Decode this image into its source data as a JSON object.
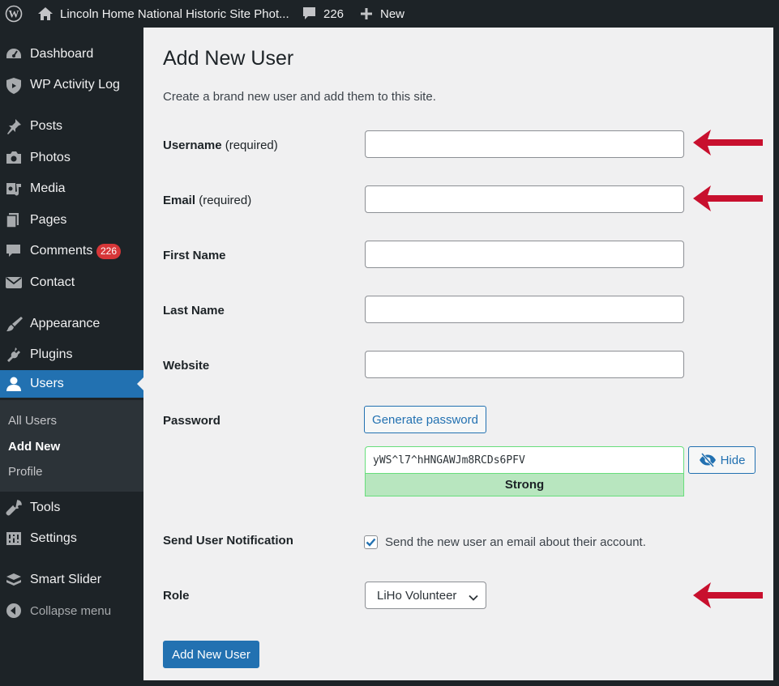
{
  "admin_bar": {
    "site_name": "Lincoln Home National Historic Site Phot...",
    "comments_count": "226",
    "new_label": "New"
  },
  "sidebar": {
    "items": [
      {
        "label": "Dashboard",
        "icon": "dashboard-icon"
      },
      {
        "label": "WP Activity Log",
        "icon": "shield-icon"
      },
      {
        "label": "Posts",
        "icon": "pushpin-icon"
      },
      {
        "label": "Photos",
        "icon": "camera-icon"
      },
      {
        "label": "Media",
        "icon": "media-icon"
      },
      {
        "label": "Pages",
        "icon": "pages-icon"
      },
      {
        "label": "Comments",
        "icon": "comment-icon",
        "badge": "226"
      },
      {
        "label": "Contact",
        "icon": "envelope-icon"
      },
      {
        "label": "Appearance",
        "icon": "paintbrush-icon"
      },
      {
        "label": "Plugins",
        "icon": "plug-icon"
      },
      {
        "label": "Users",
        "icon": "user-icon",
        "current": true
      },
      {
        "label": "Tools",
        "icon": "wrench-icon"
      },
      {
        "label": "Settings",
        "icon": "settings-icon"
      },
      {
        "label": "Smart Slider",
        "icon": "slider-icon"
      },
      {
        "label": "Collapse menu",
        "icon": "collapse-icon"
      }
    ],
    "submenu": [
      {
        "label": "All Users"
      },
      {
        "label": "Add New",
        "current": true
      },
      {
        "label": "Profile"
      }
    ]
  },
  "page": {
    "title": "Add New User",
    "description": "Create a brand new user and add them to this site."
  },
  "form": {
    "username_label": "Username",
    "username_req": "(required)",
    "username_value": "",
    "email_label": "Email",
    "email_req": "(required)",
    "email_value": "",
    "first_name_label": "First Name",
    "first_name_value": "",
    "last_name_label": "Last Name",
    "last_name_value": "",
    "website_label": "Website",
    "website_value": "",
    "password_label": "Password",
    "generate_password_label": "Generate password",
    "password_value": "yWS^l7^hHNGAWJm8RCDs6PFV",
    "password_strength": "Strong",
    "hide_label": "Hide",
    "notification_label": "Send User Notification",
    "notification_checked": true,
    "notification_text": "Send the new user an email about their account.",
    "role_label": "Role",
    "role_value": "LiHo Volunteer",
    "submit_label": "Add New User"
  },
  "colors": {
    "admin_bg": "#1d2327",
    "accent": "#2271b1",
    "badge": "#d63638",
    "annotation_arrow": "#c8102e",
    "strength_bg": "#b8e6bf"
  }
}
